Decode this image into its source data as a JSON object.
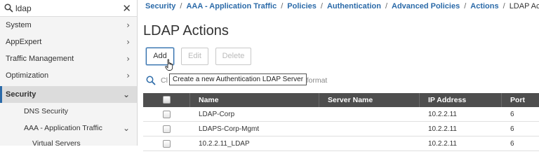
{
  "search": {
    "value": "ldap"
  },
  "nav": {
    "items": [
      {
        "label": "System"
      },
      {
        "label": "AppExpert"
      },
      {
        "label": "Traffic Management"
      },
      {
        "label": "Optimization"
      }
    ],
    "active": {
      "label": "Security"
    },
    "sub_items": [
      {
        "label": "DNS Security"
      },
      {
        "label": "AAA - Application Traffic"
      }
    ],
    "sub_sub_items": [
      {
        "label": "Virtual Servers"
      }
    ]
  },
  "breadcrumb": {
    "links": [
      "Security",
      "AAA - Application Traffic",
      "Policies",
      "Authentication",
      "Advanced Policies",
      "Actions"
    ],
    "current": "LDAP Actions",
    "separator": "/"
  },
  "page": {
    "title": "LDAP Actions"
  },
  "toolbar": {
    "add_label": "Add",
    "edit_label": "Edit",
    "delete_label": "Delete"
  },
  "tooltip": {
    "text": "Create a new Authentication LDAP Server"
  },
  "filter": {
    "prefix": "Cl",
    "suffix": "ue format"
  },
  "table": {
    "headers": {
      "name": "Name",
      "server_name": "Server Name",
      "ip_address": "IP Address",
      "port": "Port"
    },
    "rows": [
      {
        "name": "LDAP-Corp",
        "server_name": "",
        "ip_address": "10.2.2.11",
        "port": "6"
      },
      {
        "name": "LDAPS-Corp-Mgmt",
        "server_name": "",
        "ip_address": "10.2.2.11",
        "port": "6"
      },
      {
        "name": "10.2.2.11_LDAP",
        "server_name": "",
        "ip_address": "10.2.2.11",
        "port": "6"
      }
    ]
  },
  "colors": {
    "accent": "#2b6aa8",
    "header_bg": "#4e4e4e",
    "sidebar_bg": "#f4f4f4"
  }
}
